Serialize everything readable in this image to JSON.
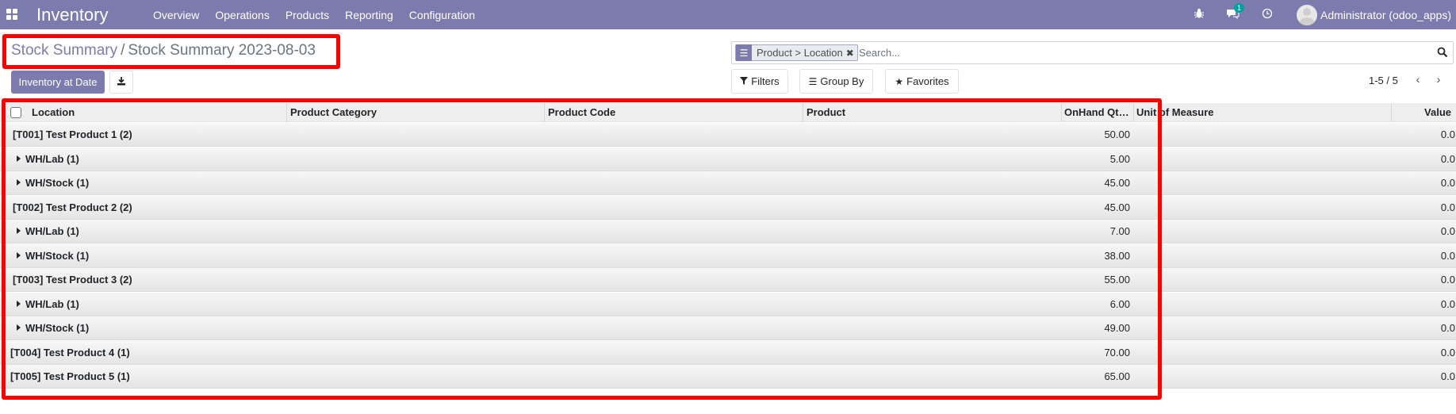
{
  "navbar": {
    "app_title": "Inventory",
    "menu": [
      "Overview",
      "Operations",
      "Products",
      "Reporting",
      "Configuration"
    ],
    "messages_badge": "1",
    "user": "Administrator (odoo_apps)"
  },
  "breadcrumb": {
    "parent": "Stock Summary",
    "separator": "/",
    "current": "Stock Summary 2023-08-03"
  },
  "actions": {
    "inventory_at_date": "Inventory at Date"
  },
  "search": {
    "facet": "Product > Location",
    "placeholder": "Search..."
  },
  "controls": {
    "filters": "Filters",
    "group_by": "Group By",
    "favorites": "Favorites"
  },
  "pager": {
    "text": "1-5 / 5"
  },
  "table": {
    "columns": {
      "location": "Location",
      "product_category": "Product Category",
      "product_code": "Product Code",
      "product": "Product",
      "onhand_qty": "OnHand Qt…",
      "uom": "Unit of Measure",
      "value": "Value"
    },
    "rows": [
      {
        "label": "[T001] Test Product 1 (2)",
        "qty": "50.00",
        "value": "0.0",
        "level": 0
      },
      {
        "label": "WH/Lab (1)",
        "qty": "5.00",
        "value": "0.0",
        "level": 1
      },
      {
        "label": "WH/Stock (1)",
        "qty": "45.00",
        "value": "0.0",
        "level": 1
      },
      {
        "label": "[T002] Test Product 2 (2)",
        "qty": "45.00",
        "value": "0.0",
        "level": 0
      },
      {
        "label": "WH/Lab (1)",
        "qty": "7.00",
        "value": "0.0",
        "level": 1
      },
      {
        "label": "WH/Stock (1)",
        "qty": "38.00",
        "value": "0.0",
        "level": 1
      },
      {
        "label": "[T003] Test Product 3 (2)",
        "qty": "55.00",
        "value": "0.0",
        "level": 0
      },
      {
        "label": "WH/Lab (1)",
        "qty": "6.00",
        "value": "0.0",
        "level": 1
      },
      {
        "label": "WH/Stock (1)",
        "qty": "49.00",
        "value": "0.0",
        "level": 1
      },
      {
        "label": "[T004] Test Product 4 (1)",
        "qty": "70.00",
        "value": "0.0",
        "level": 0
      },
      {
        "label": "[T005] Test Product 5 (1)",
        "qty": "65.00",
        "value": "0.0",
        "level": 0
      }
    ]
  }
}
